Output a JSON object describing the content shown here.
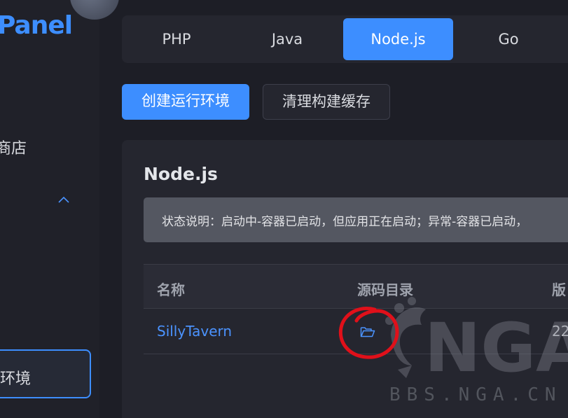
{
  "sidebar": {
    "logo": "Panel",
    "store_label": "商店",
    "active_item_label": "环境"
  },
  "tabs": [
    {
      "label": "PHP"
    },
    {
      "label": "Java"
    },
    {
      "label": "Node.js",
      "active": true
    },
    {
      "label": "Go"
    }
  ],
  "toolbar": {
    "create_label": "创建运行环境",
    "clear_cache_label": "清理构建缓存"
  },
  "card": {
    "title": "Node.js",
    "alert": "状态说明：启动中-容器已启动，但应用正在启动；异常-容器已启动，"
  },
  "table": {
    "headers": [
      "名称",
      "源码目录",
      "版"
    ],
    "rows": [
      {
        "name": "SillyTavern",
        "source_icon": "folder-icon",
        "version": "22"
      }
    ]
  },
  "watermark": {
    "logo_text": "NGA",
    "domain": "BBS.NGA.CN"
  },
  "colors": {
    "accent": "#3d8eff",
    "background": "#1d1e26",
    "card": "#25262f",
    "annotation": "#e0101a"
  }
}
